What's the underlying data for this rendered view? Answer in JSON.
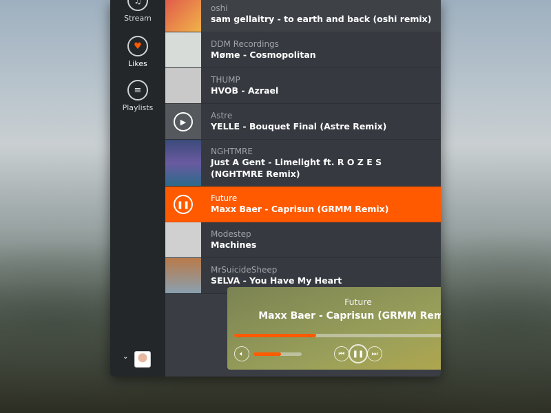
{
  "sidebar": {
    "items": [
      {
        "label": "Stream",
        "icon": "music-note-icon"
      },
      {
        "label": "Likes",
        "icon": "heart-icon"
      },
      {
        "label": "Playlists",
        "icon": "list-icon"
      }
    ]
  },
  "tracks": [
    {
      "artist": "oshi",
      "title": "sam gellaitry - to earth and back (oshi remix)"
    },
    {
      "artist": "DDM Recordings",
      "title": "Møme - Cosmopolitan"
    },
    {
      "artist": "THUMP",
      "title": "HVOB - Azrael"
    },
    {
      "artist": "Astre",
      "title": "YELLE - Bouquet Final (Astre Remix)"
    },
    {
      "artist": "NGHTMRE",
      "title": "Just A Gent - Limelight ft. R O Z E S (NGHTMRE Remix)"
    },
    {
      "artist": "Future",
      "title": "Maxx Baer - Caprisun (GRMM Remix)"
    },
    {
      "artist": "Modestep",
      "title": "Machines"
    },
    {
      "artist": "MrSuicideSheep",
      "title": "SELVA - You Have My Heart"
    }
  ],
  "player": {
    "artist": "Future",
    "title": "Maxx Baer - Caprisun (GRMM Remix)",
    "progress_pct": 33,
    "volume_pct": 57
  },
  "colors": {
    "accent": "#ff5a00"
  }
}
